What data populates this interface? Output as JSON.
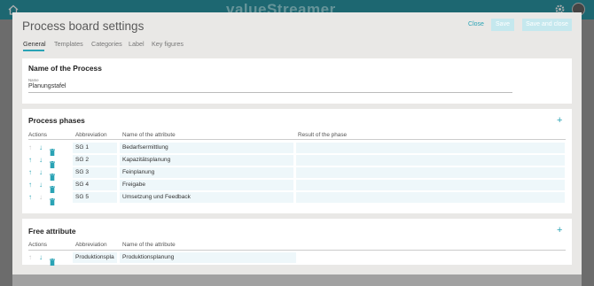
{
  "app": {
    "brand": "valueStreamer"
  },
  "modal": {
    "title": "Process board settings",
    "close_label": "Close",
    "save_label": "Save",
    "save_close_label": "Save and close"
  },
  "tabs": [
    {
      "label": "General",
      "active": true
    },
    {
      "label": "Templates",
      "active": false
    },
    {
      "label": "Categories",
      "active": false
    },
    {
      "label": "Label",
      "active": false
    },
    {
      "label": "Key figures",
      "active": false
    }
  ],
  "name_section": {
    "title": "Name of the Process",
    "field_label": "Name",
    "field_value": "Planungstafel"
  },
  "phases": {
    "title": "Process phases",
    "headers": {
      "actions": "Actions",
      "abbreviation": "Abbreviation",
      "attribute": "Name of the attribute",
      "result": "Result of the phase"
    },
    "rows": [
      {
        "abbr": "SG 1",
        "name": "Bedarfsermittlung",
        "result": "",
        "up_enabled": false,
        "down_enabled": true
      },
      {
        "abbr": "SG 2",
        "name": "Kapazitätsplanung",
        "result": "",
        "up_enabled": true,
        "down_enabled": true
      },
      {
        "abbr": "SG 3",
        "name": "Feinplanung",
        "result": "",
        "up_enabled": true,
        "down_enabled": true
      },
      {
        "abbr": "SG 4",
        "name": "Freigabe",
        "result": "",
        "up_enabled": true,
        "down_enabled": true
      },
      {
        "abbr": "SG 5",
        "name": "Umsetzung und Feedback",
        "result": "",
        "up_enabled": true,
        "down_enabled": false
      }
    ]
  },
  "free_attribute": {
    "title": "Free attribute",
    "headers": {
      "actions": "Actions",
      "abbreviation": "Abbreviation",
      "attribute": "Name of the attribute"
    },
    "rows": [
      {
        "abbr": "Produktionspla",
        "name": "Produktionsplanung",
        "up_enabled": false,
        "down_enabled": true
      }
    ]
  },
  "colors": {
    "accent": "#2aa3b5",
    "cell_bg": "#eef7fa",
    "disabled_arrow": "#c9c9c9"
  }
}
